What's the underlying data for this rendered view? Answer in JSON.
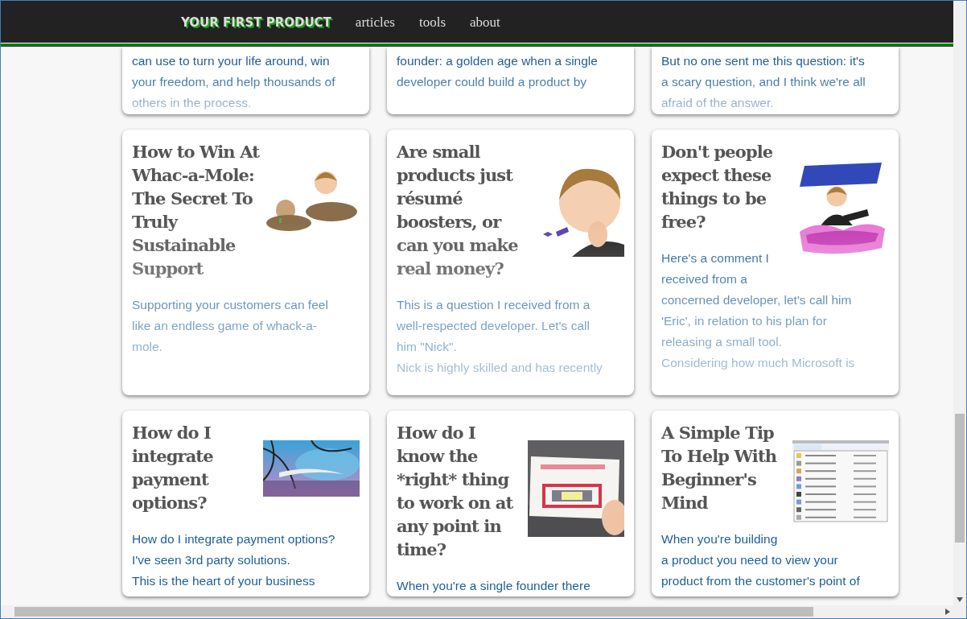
{
  "header": {
    "logo": "YOUR FIRST PRODUCT",
    "nav": [
      "articles",
      "tools",
      "about"
    ]
  },
  "top_cards": [
    {
      "lines": [
        "can use to turn your life around, win",
        "your freedom, and help thousands of",
        "others in the process."
      ]
    },
    {
      "lines": [
        "founder: a golden age when a single",
        "developer could build a product by"
      ]
    },
    {
      "lines": [
        "But no one sent me this question: it's",
        "a scary question, and I think we're all",
        "afraid of the answer."
      ]
    }
  ],
  "cards": [
    {
      "title": "How to Win At Whac-a-Mole: The Secret To Truly Sustainable Support",
      "image": {
        "kind": "picture"
      },
      "lines": [
        "Supporting your customers can feel",
        "like an endless game of whack-a-",
        "mole."
      ]
    },
    {
      "title": "Are small products just résumé boosters, or can you make real money?",
      "image": {
        "kind": "picture"
      },
      "lines": [
        "This is a question I received from a",
        "well-respected developer. Let's call",
        "him \"Nick\".",
        "Nick is highly skilled and has recently"
      ]
    },
    {
      "title": "Don't people expect these things to be free?",
      "image": {
        "kind": "picture"
      },
      "lines": [
        "Here's a comment I",
        "received from a",
        "concerned developer, let's call him",
        "'Eric', in relation to his plan for",
        "releasing a small tool.",
        "Considering how much Microsoft is"
      ]
    },
    {
      "title": "How do I integrate payment options?",
      "image": {
        "kind": "picture"
      },
      "lines": [
        "How do I integrate payment options?",
        "I've seen 3rd party solutions.",
        "This is the heart of your business"
      ]
    },
    {
      "title": "How do I know the *right* thing to work on at any point in time?",
      "image": {
        "kind": "picture"
      },
      "lines": [
        "When you're a single founder there"
      ]
    },
    {
      "title": "A Simple Tip To Help With Beginner's Mind",
      "image": {
        "kind": "picture"
      },
      "lines": [
        "When you're building",
        "a product you need to view your",
        "product from the customer's point of"
      ]
    }
  ]
}
